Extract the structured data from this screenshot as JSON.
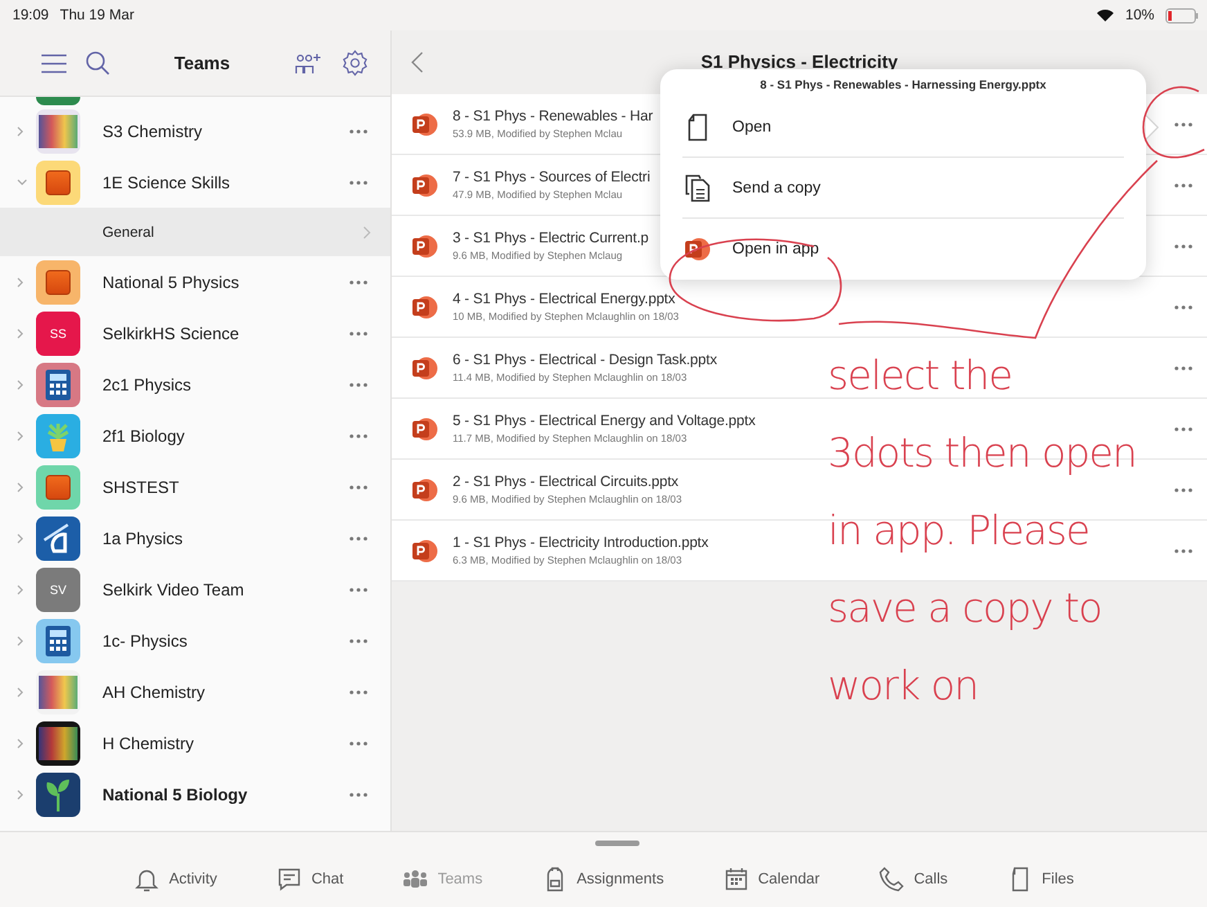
{
  "status_bar": {
    "time": "19:09",
    "date": "Thu 19 Mar",
    "battery": "10%"
  },
  "sidebar": {
    "title": "Teams",
    "teams": [
      {
        "name": "S3 Chemistry",
        "expanded": false,
        "unread": false,
        "icon": {
          "kind": "photo",
          "color": "#e8e4ef"
        }
      },
      {
        "name": "1E Science Skills",
        "expanded": true,
        "unread": false,
        "icon": {
          "kind": "square",
          "color": "#fcd978"
        },
        "channels": [
          {
            "name": "General",
            "selected": true
          }
        ]
      },
      {
        "name": "National 5 Physics",
        "expanded": false,
        "unread": false,
        "icon": {
          "kind": "square",
          "color": "#f7b56a"
        }
      },
      {
        "name": "SelkirkHS Science",
        "expanded": false,
        "unread": false,
        "icon": {
          "kind": "initials",
          "color": "#e5174b",
          "initials": "SS"
        }
      },
      {
        "name": "2c1 Physics",
        "expanded": false,
        "unread": false,
        "icon": {
          "kind": "calculator",
          "color": "#d77884"
        }
      },
      {
        "name": "2f1 Biology",
        "expanded": false,
        "unread": false,
        "icon": {
          "kind": "plant",
          "color": "#2aaee2"
        }
      },
      {
        "name": "SHSTEST",
        "expanded": false,
        "unread": false,
        "icon": {
          "kind": "square",
          "color": "#6fd6aa"
        }
      },
      {
        "name": "1a Physics",
        "expanded": false,
        "unread": false,
        "icon": {
          "kind": "protractor",
          "color": "#1c5ea8"
        }
      },
      {
        "name": "Selkirk Video Team",
        "expanded": false,
        "unread": false,
        "icon": {
          "kind": "initials",
          "color": "#7b7b7b",
          "initials": "SV"
        }
      },
      {
        "name": "1c- Physics",
        "expanded": false,
        "unread": false,
        "icon": {
          "kind": "calculator",
          "color": "#86c8ef"
        }
      },
      {
        "name": "AH Chemistry",
        "expanded": false,
        "unread": false,
        "icon": {
          "kind": "photo",
          "color": "#f2f2f2"
        }
      },
      {
        "name": "H Chemistry",
        "expanded": false,
        "unread": false,
        "icon": {
          "kind": "photo",
          "color": "#151515"
        }
      },
      {
        "name": "National 5 Biology",
        "expanded": false,
        "unread": true,
        "icon": {
          "kind": "leaf",
          "color": "#1b3e6e"
        }
      }
    ]
  },
  "channel": {
    "title": "S1 Physics - Electricity",
    "files": [
      {
        "name": "8 - S1 Phys - Renewables - Har",
        "details": "53.9 MB, Modified by Stephen Mclau"
      },
      {
        "name": "7 - S1 Phys - Sources of Electri",
        "details": "47.9 MB, Modified by Stephen Mclau"
      },
      {
        "name": "3 - S1 Phys - Electric Current.p",
        "details": "9.6 MB, Modified by Stephen Mclaug"
      },
      {
        "name": "4 - S1 Phys - Electrical Energy.pptx",
        "details": "10 MB, Modified by Stephen Mclaughlin on 18/03"
      },
      {
        "name": "6 - S1 Phys - Electrical - Design Task.pptx",
        "details": "11.4 MB, Modified by Stephen Mclaughlin on 18/03"
      },
      {
        "name": "5 - S1 Phys - Electrical Energy and Voltage.pptx",
        "details": "11.7 MB, Modified by Stephen Mclaughlin on 18/03"
      },
      {
        "name": "2 - S1 Phys - Electrical Circuits.pptx",
        "details": "9.6 MB, Modified by Stephen Mclaughlin on 18/03"
      },
      {
        "name": "1 - S1 Phys - Electricity Introduction.pptx",
        "details": "6.3 MB, Modified by Stephen Mclaughlin on 18/03"
      }
    ]
  },
  "action_sheet": {
    "title": "8 - S1 Phys - Renewables - Harnessing Energy.pptx",
    "actions": [
      {
        "kind": "document",
        "label": "Open"
      },
      {
        "kind": "copy",
        "label": "Send a copy"
      },
      {
        "kind": "powerpoint",
        "label": "Open in app"
      }
    ]
  },
  "tab_bar": {
    "tabs": [
      {
        "kind": "bell",
        "label": "Activity",
        "selected": false
      },
      {
        "kind": "chat",
        "label": "Chat",
        "selected": false
      },
      {
        "kind": "people",
        "label": "Teams",
        "selected": true
      },
      {
        "kind": "backpack",
        "label": "Assignments",
        "selected": false
      },
      {
        "kind": "calendar",
        "label": "Calendar",
        "selected": false
      },
      {
        "kind": "phone",
        "label": "Calls",
        "selected": false
      },
      {
        "kind": "file",
        "label": "Files",
        "selected": false
      }
    ]
  },
  "annotation": {
    "lines": [
      "select the",
      "3dots then open",
      "in app. Please",
      "save a copy to",
      "work on"
    ]
  }
}
